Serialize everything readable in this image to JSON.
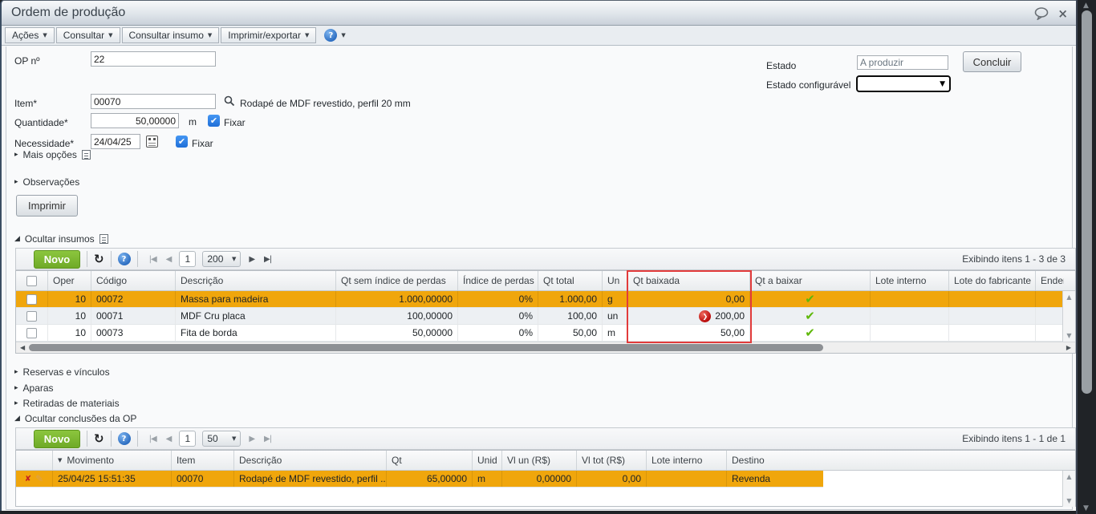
{
  "window": {
    "title": "Ordem de produção"
  },
  "menu": {
    "items": [
      "Ações",
      "Consultar",
      "Consultar insumo",
      "Imprimir/exportar"
    ],
    "help": "?"
  },
  "icons": {
    "caret_down": "▼",
    "tri_collapsed": "▸",
    "tri_expanded": "◢",
    "pager_first": "|◀",
    "pager_prev": "◀",
    "pager_next": "▶",
    "pager_last": "▶|",
    "refresh": "↻",
    "help": "?",
    "close": "×",
    "check": "✔",
    "drill_arrow": "❯",
    "delete": "✘",
    "pencil": "✎",
    "up": "▲",
    "down": "▼",
    "left": "◀",
    "right": "▶",
    "sort_desc": "▼",
    "checkmark_white": "✔"
  },
  "form": {
    "op_label": "OP nº",
    "op_value": "22",
    "estado_label": "Estado",
    "estado_value": "A produzir",
    "estado_conf_label": "Estado configurável",
    "concluir_button": "Concluir",
    "item_label": "Item*",
    "item_value": "00070",
    "item_desc": "Rodapé de MDF revestido, perfil 20 mm",
    "qty_label": "Quantidade*",
    "qty_value": "50,00000",
    "qty_unit": "m",
    "fixar_label": "Fixar",
    "need_label": "Necessidade*",
    "need_value": "24/04/25",
    "more_options_label": "Mais opções",
    "observations_label": "Observações",
    "print_button": "Imprimir"
  },
  "insumos": {
    "section_label": "Ocultar insumos",
    "toolbar": {
      "new_button": "Novo",
      "page": "1",
      "page_size": "200",
      "status": "Exibindo itens 1 - 3 de 3"
    },
    "columns": [
      "Oper",
      "Código",
      "Descrição",
      "Qt sem índice de perdas",
      "Índice de perdas",
      "Qt total",
      "Un",
      "Qt baixada",
      "Qt a baixar",
      "Lote interno",
      "Lote do fabricante",
      "Ender"
    ],
    "rows": [
      {
        "oper": "10",
        "codigo": "00072",
        "descricao": "Massa para madeira",
        "qt_sem_indice": "1.000,00000",
        "indice_perdas": "0%",
        "qt_total": "1.000,00",
        "un": "g",
        "qt_baixada": "0,00"
      },
      {
        "oper": "10",
        "codigo": "00071",
        "descricao": "MDF Cru placa",
        "qt_sem_indice": "100,00000",
        "indice_perdas": "0%",
        "qt_total": "100,00",
        "un": "un",
        "qt_baixada": "200,00"
      },
      {
        "oper": "10",
        "codigo": "00073",
        "descricao": "Fita de borda",
        "qt_sem_indice": "50,00000",
        "indice_perdas": "0%",
        "qt_total": "50,00",
        "un": "m",
        "qt_baixada": "50,00"
      }
    ]
  },
  "sections": {
    "reservas": "Reservas e vínculos",
    "aparas": "Aparas",
    "retiradas": "Retiradas de materiais",
    "conclusoes": "Ocultar conclusões da OP"
  },
  "conclusoes": {
    "toolbar": {
      "new_button": "Novo",
      "page": "1",
      "page_size": "50",
      "status": "Exibindo itens 1 - 1 de 1"
    },
    "columns": [
      "Movimento",
      "Item",
      "Descrição",
      "Qt",
      "Unid",
      "Vl un (R$)",
      "Vl tot (R$)",
      "Lote interno",
      "Destino"
    ],
    "rows": [
      {
        "movimento": "25/04/25 15:51:35",
        "item": "00070",
        "descricao": "Rodapé de MDF revestido, perfil ...",
        "qt": "65,00000",
        "unid": "m",
        "vl_un": "0,00000",
        "vl_tot": "0,00",
        "lote_interno": "",
        "destino": "Revenda"
      }
    ]
  },
  "colors": {
    "selected_row": "#F0A60C",
    "new_button_green": "#76B82A",
    "red_highlight_box": "#E23B3B",
    "check_green": "#5FB80A",
    "drill_red": "#B90C0C",
    "titlebar_gradient_end": "#C9D0D9",
    "scrollbar_track_dark": "#202327"
  }
}
